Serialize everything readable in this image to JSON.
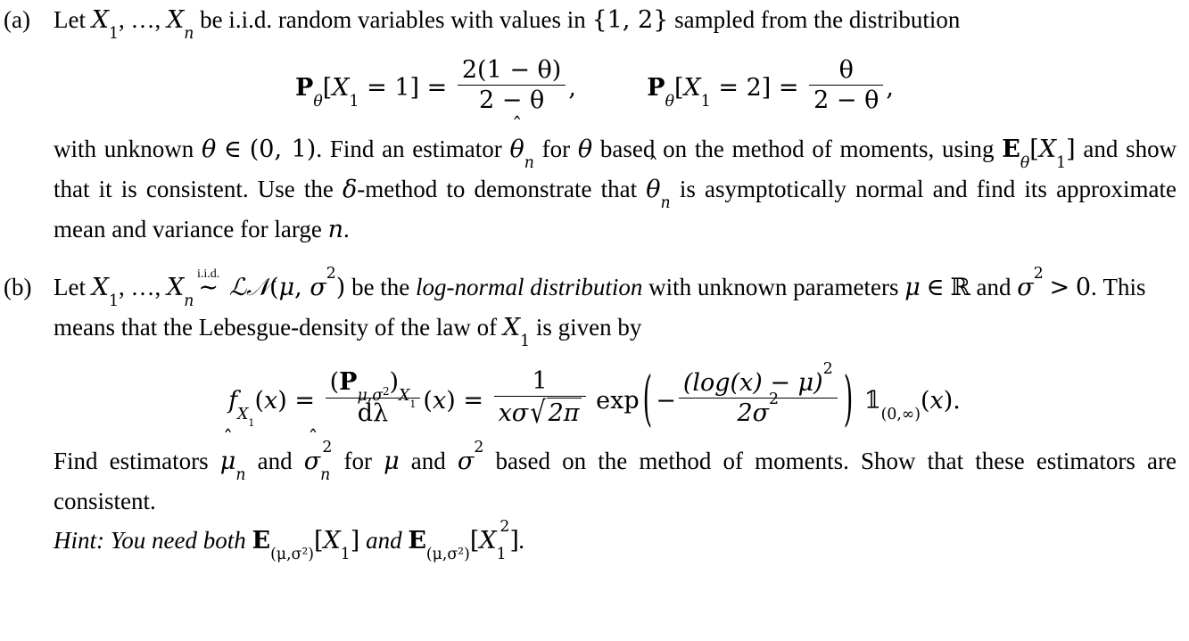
{
  "document": {
    "type": "math-exercise-sheet",
    "background_color": "#ffffff",
    "text_color": "#000000"
  },
  "items": [
    {
      "label": "(a)",
      "line1_part1": "Let",
      "line1_x1": "X",
      "line1_x1_sub": "1",
      "line1_dots": ", …,",
      "line1_xn": "X",
      "line1_xn_sub": "n",
      "line1_part2": "be i.i.d. random variables with values in",
      "set_open": "{",
      "set_1": "1",
      "set_comma": ",",
      "set_2": "2",
      "set_close": "}",
      "line1_part3": "sampled from the distribution",
      "equation": {
        "left": {
          "P": "P",
          "P_sub": "θ",
          "bracket_open": "[",
          "X": "X",
          "X_sub": "1",
          "eq": "=",
          "value": "1",
          "bracket_close": "]",
          "equals": "=",
          "numerator": "2(1 − θ)",
          "denominator": "2 − θ",
          "trailing": ","
        },
        "right": {
          "P": "P",
          "P_sub": "θ",
          "bracket_open": "[",
          "X": "X",
          "X_sub": "1",
          "eq": "=",
          "value": "2",
          "bracket_close": "]",
          "equals": "=",
          "numerator": "θ",
          "denominator": "2 − θ",
          "trailing": ","
        }
      },
      "para2_a": "with unknown",
      "para2_theta": "θ",
      "para2_in": "∈",
      "para2_interval": "(0, 1)",
      "para2_b": ". Find an estimator",
      "para2_theta_hat": "θ",
      "para2_theta_hat_sub": "n",
      "para2_c": "for",
      "para2_theta2": "θ",
      "para2_d": "based on the method of moments, using",
      "para2_E": "E",
      "para2_E_sub": "θ",
      "para2_E_arg_open": "[",
      "para2_E_X": "X",
      "para2_E_X_sub": "1",
      "para2_E_arg_close": "]",
      "para2_e": "and show that it is consistent. Use the",
      "para2_delta": "δ",
      "para2_f": "-method to demonstrate that",
      "para2_theta_hat2": "θ",
      "para2_theta_hat2_sub": "n",
      "para2_g": "is asymptotically normal and find its approximate mean and variance for large",
      "para2_n": "n",
      "para2_h": "."
    },
    {
      "label": "(b)",
      "line1_part1": "Let",
      "line1_x1": "X",
      "line1_x1_sub": "1",
      "line1_dots": ", …,",
      "line1_xn": "X",
      "line1_xn_sub": "n",
      "rel_over": "i.i.d.",
      "rel_symbol": "∼",
      "dist_L": "ℒ",
      "dist_N": "𝒩",
      "dist_open": "(",
      "dist_mu": "μ",
      "dist_comma": ",",
      "dist_sigma": "σ",
      "dist_sigma_sup": "2",
      "dist_close": ")",
      "line1_part2": "be the",
      "line1_emph": "log-normal distribution",
      "line1_part3": "with unknown parameters",
      "line1_mu": "μ",
      "line1_in": "∈",
      "line1_R": "ℝ",
      "line2_and": "and",
      "line2_sigma": "σ",
      "line2_sigma_sup": "2",
      "line2_gt": ">",
      "line2_zero": "0",
      "line2_rest": ". This means that the Lebesgue-density of the law of",
      "line2_X": "X",
      "line2_X_sub": "1",
      "line2_tail": "is given by",
      "equation": {
        "f": "f",
        "f_sub_X": "X",
        "f_sub_X_sub": "1",
        "arg_open": "(",
        "arg_x": "x",
        "arg_close": ")",
        "equals1": "=",
        "num_P": "P",
        "num_P_sub_mu": "μ",
        "num_P_sub_comma": ",",
        "num_P_sub_sigma": "σ",
        "num_P_sub_sigma_sup": "2",
        "num_sub_X": "X",
        "num_sub_X_sub": "1",
        "den": "dλ",
        "of_open": "(",
        "of_x": "x",
        "of_close": ")",
        "equals2": "=",
        "frac2_num": "1",
        "frac2_den_x": "x",
        "frac2_den_sigma": "σ",
        "frac2_den_radicand": "2π",
        "exp": "exp",
        "minus": "−",
        "exp_num": "(log(x) − μ)",
        "exp_num_sup": "2",
        "exp_den": "2σ",
        "exp_den_sup": "2",
        "indicator": "𝟙",
        "indicator_sub": "(0,∞)",
        "ind_arg_open": "(",
        "ind_arg_x": "x",
        "ind_arg_close": ")",
        "period": "."
      },
      "para2_a": "Find estimators",
      "para2_mu_hat": "μ",
      "para2_mu_hat_sub": "n",
      "para2_and": "and",
      "para2_sigma_hat": "σ",
      "para2_sigma_hat_sub": "n",
      "para2_sigma_hat_sup": "2",
      "para2_for": "for",
      "para2_mu": "μ",
      "para2_and2": "and",
      "para2_sigma": "σ",
      "para2_sigma_sup": "2",
      "para2_rest": "based on the method of moments. Show that these estimators are consistent.",
      "hint_label": "Hint:",
      "hint_a": "You need both",
      "hint_E1": "E",
      "hint_E1_sub": "(μ,σ²)",
      "hint_E1_open": "[",
      "hint_E1_X": "X",
      "hint_E1_X_sub": "1",
      "hint_E1_close": "]",
      "hint_b": "and",
      "hint_E2": "E",
      "hint_E2_sub": "(μ,σ²)",
      "hint_E2_open": "[",
      "hint_E2_X": "X",
      "hint_E2_X_sub": "1",
      "hint_E2_X_sup": "2",
      "hint_E2_close": "]",
      "hint_period": "."
    }
  ]
}
